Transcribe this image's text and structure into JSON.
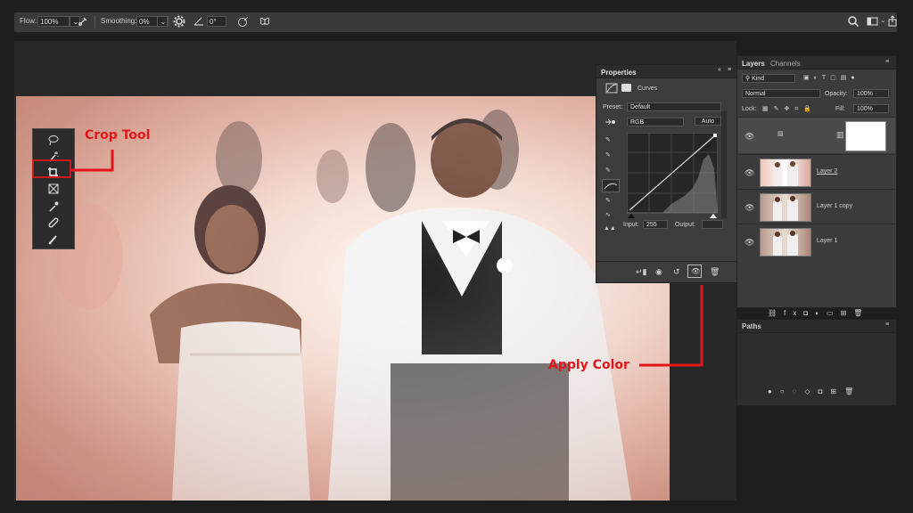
{
  "options_bar": {
    "flow_label": "Flow:",
    "flow_value": "100%",
    "smoothing_label": "Smoothing:",
    "smoothing_value": "0%",
    "angle_value": "0°"
  },
  "annotations": {
    "crop_tool": "Crop Tool",
    "apply_color": "Apply Color"
  },
  "properties": {
    "title": "Properties",
    "adjustment": "Curves",
    "preset_label": "Preset:",
    "preset_value": "Default",
    "channel_value": "RGB",
    "auto_label": "Auto",
    "input_label": "Input:",
    "input_value": "255",
    "output_label": "Output:"
  },
  "layers_panel": {
    "tabs": [
      "Layers",
      "Channels"
    ],
    "kind_value": "Kind",
    "blend_mode": "Normal",
    "opacity_label": "Opacity:",
    "opacity_value": "100%",
    "lock_label": "Lock:",
    "fill_label": "Fill:",
    "fill_value": "100%",
    "layers": [
      "Layer 2",
      "Layer 1 copy",
      "Layer 1"
    ]
  },
  "paths_panel": {
    "title": "Paths"
  },
  "colors": {
    "annotation_red": "#e4141b",
    "panel_bg": "#3c3c3c",
    "app_bg": "#1e1e1e"
  },
  "icons": [
    "brush-pressure-icon",
    "settings-gear-icon",
    "angle-icon",
    "symmetry-icon",
    "butterfly-icon",
    "search-icon",
    "workspace-icon",
    "share-icon"
  ]
}
